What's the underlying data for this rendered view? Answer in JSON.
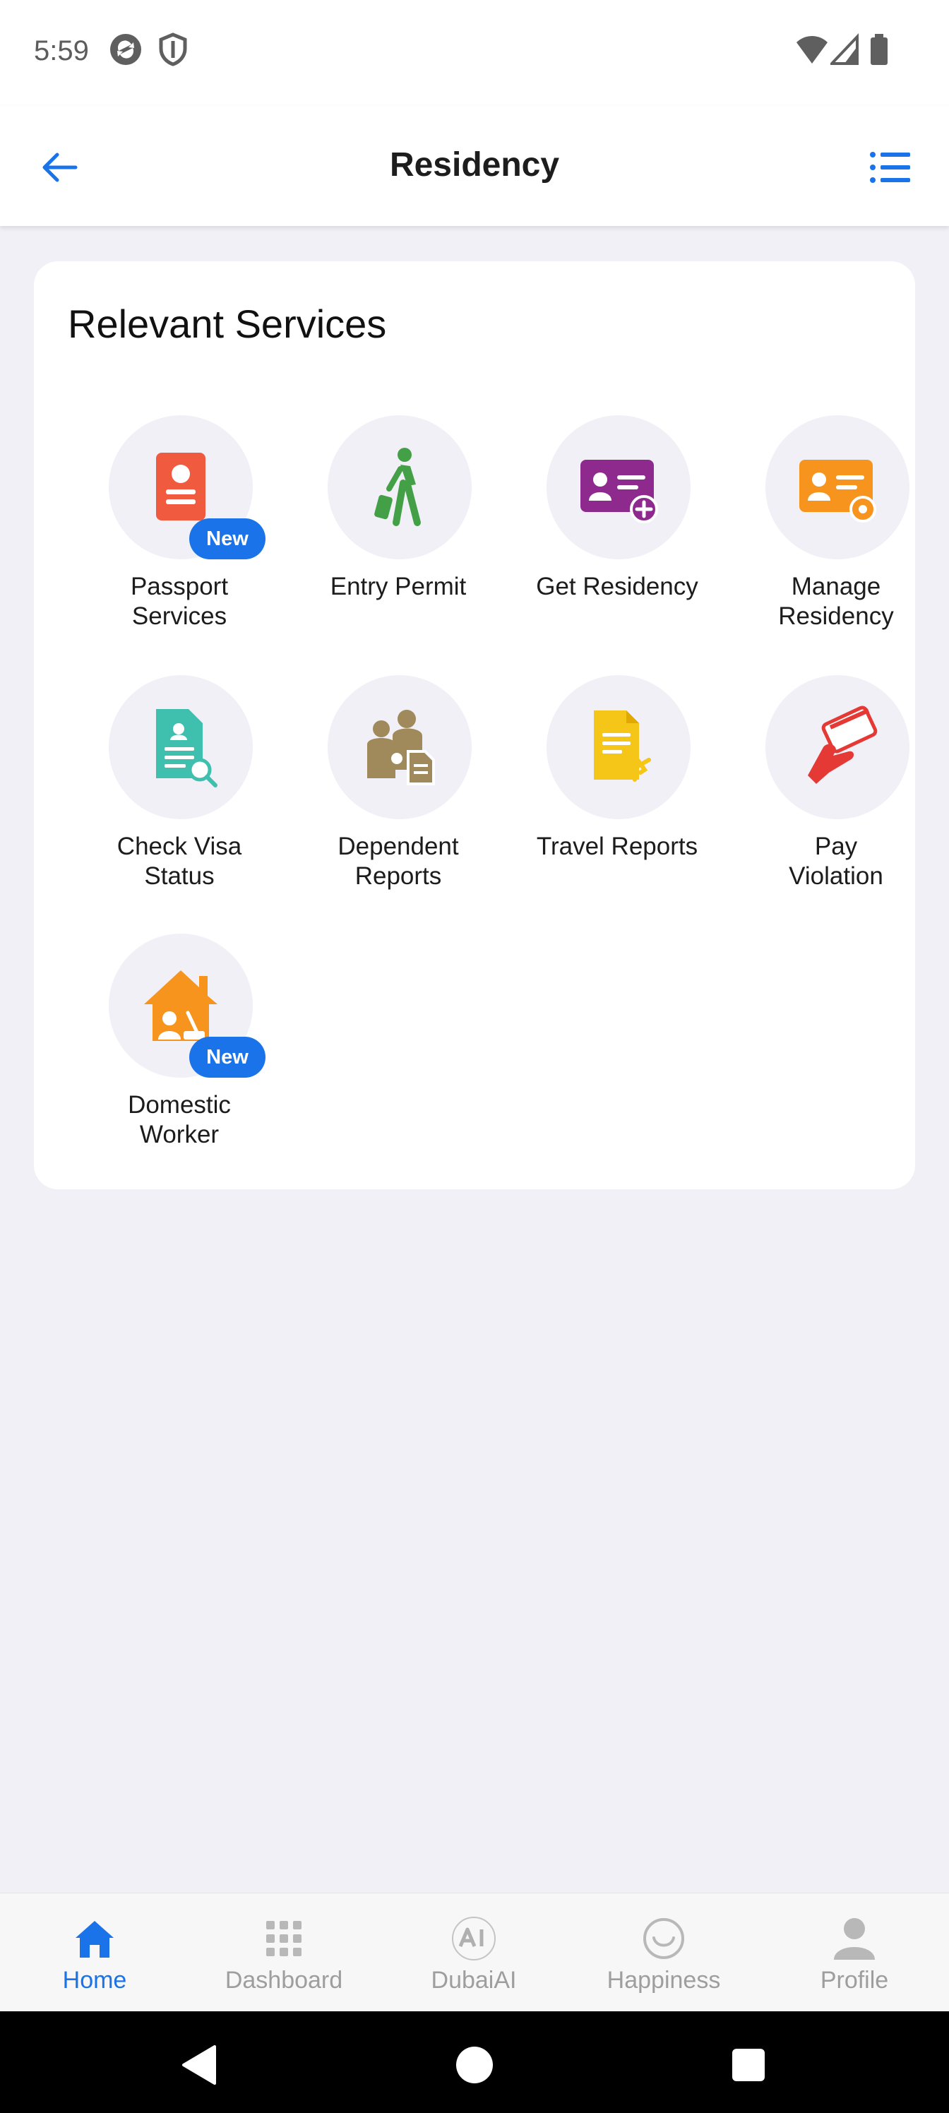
{
  "status_bar": {
    "time": "5:59",
    "icons_left": [
      "sync-icon",
      "shield-icon"
    ],
    "icons_right": [
      "wifi-icon",
      "cell-signal-icon",
      "battery-icon"
    ]
  },
  "header": {
    "title": "Residency",
    "back_icon": "back-arrow-icon",
    "menu_icon": "list-menu-icon"
  },
  "section": {
    "title": "Relevant Services",
    "services": [
      {
        "label": "Passport\nServices",
        "icon": "passport-icon",
        "color": "#f05a3e",
        "badge": "New"
      },
      {
        "label": "Entry Permit",
        "icon": "traveler-icon",
        "color": "#43a047",
        "badge": ""
      },
      {
        "label": "Get Residency",
        "icon": "id-card-add-icon",
        "color": "#8e2a8e",
        "badge": ""
      },
      {
        "label": "Manage\nResidency",
        "icon": "id-card-settings-icon",
        "color": "#f7941d",
        "badge": ""
      },
      {
        "label": "Check Visa\nStatus",
        "icon": "document-search-icon",
        "color": "#3fbfad",
        "badge": ""
      },
      {
        "label": "Dependent\nReports",
        "icon": "family-report-icon",
        "color": "#a08a5c",
        "badge": ""
      },
      {
        "label": "Travel Reports",
        "icon": "travel-document-icon",
        "color": "#f5c518",
        "badge": ""
      },
      {
        "label": "Pay\nViolation",
        "icon": "card-payment-icon",
        "color": "#e53935",
        "badge": ""
      },
      {
        "label": "Domestic\nWorker",
        "icon": "house-worker-icon",
        "color": "#f7941d",
        "badge": "New"
      }
    ]
  },
  "bottom_nav": [
    {
      "label": "Home",
      "icon": "home-icon",
      "active": true
    },
    {
      "label": "Dashboard",
      "icon": "grid-icon",
      "active": false
    },
    {
      "label": "DubaiAI",
      "icon": "ai-icon",
      "active": false
    },
    {
      "label": "Happiness",
      "icon": "smiley-icon",
      "active": false
    },
    {
      "label": "Profile",
      "icon": "person-icon",
      "active": false
    }
  ],
  "colors": {
    "accent": "#1a73e8",
    "background": "#f1f0f6",
    "card": "#ffffff"
  }
}
